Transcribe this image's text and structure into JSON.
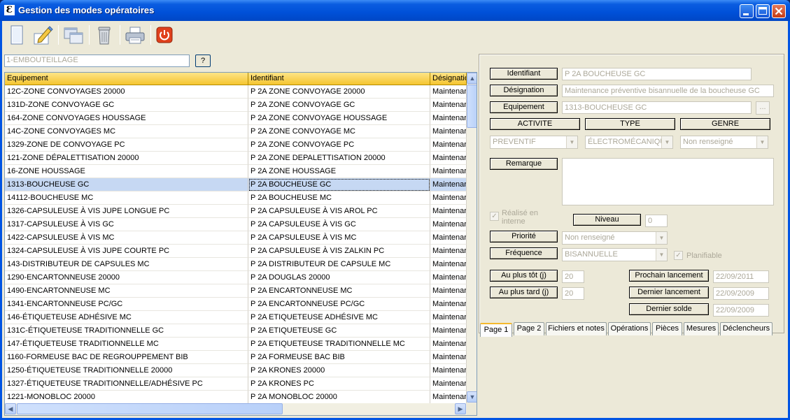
{
  "window": {
    "title": "Gestion des modes opératoires",
    "app_icon": "Ɛ"
  },
  "toolbar": {
    "tools": [
      {
        "name": "new-document-icon"
      },
      {
        "name": "edit-pencil-icon"
      },
      {
        "name": "duplicate-windows-icon"
      },
      {
        "name": "trash-icon"
      },
      {
        "name": "printer-icon"
      },
      {
        "name": "power-quit-icon"
      }
    ]
  },
  "filter": {
    "value": "1-EMBOUTEILLAGE",
    "button_label": "?"
  },
  "grid": {
    "columns": [
      "Equipement",
      "Identifiant",
      "Désignation"
    ],
    "rows": [
      [
        "12C-ZONE CONVOYAGES 20000",
        "P 2A  ZONE CONVOYAGE 20000",
        "Maintenar"
      ],
      [
        "131D-ZONE CONVOYAGE GC",
        "P 2A  ZONE CONVOYAGE GC",
        "Maintenar"
      ],
      [
        "164-ZONE CONVOYAGES HOUSSAGE",
        "P 2A  ZONE CONVOYAGE HOUSSAGE",
        "Maintenar"
      ],
      [
        "14C-ZONE CONVOYAGES MC",
        "P 2A  ZONE CONVOYAGE MC",
        "Maintenar"
      ],
      [
        "1329-ZONE DE CONVOYAGE PC",
        "P 2A  ZONE CONVOYAGE PC",
        "Maintenar"
      ],
      [
        "121-ZONE DÉPALETTISATION 20000",
        "P 2A  ZONE DEPALETTISATION 20000",
        "Maintenar"
      ],
      [
        "16-ZONE HOUSSAGE",
        "P 2A  ZONE HOUSSAGE",
        "Maintenar"
      ],
      [
        "1313-BOUCHEUSE GC",
        "P 2A BOUCHEUSE GC",
        "Maintenar"
      ],
      [
        "14112-BOUCHEUSE MC",
        "P 2A BOUCHEUSE MC",
        "Maintenar"
      ],
      [
        "1326-CAPSULEUSE À VIS JUPE LONGUE PC",
        "P 2A CAPSULEUSE À VIS AROL PC",
        "Maintenar"
      ],
      [
        "1317-CAPSULEUSE À VIS GC",
        "P 2A CAPSULEUSE À VIS GC",
        "Maintenar"
      ],
      [
        "1422-CAPSULEUSE À VIS MC",
        "P 2A CAPSULEUSE À VIS MC",
        "Maintenar"
      ],
      [
        "1324-CAPSULEUSE À VIS JUPE COURTE PC",
        "P 2A CAPSULEUSE À VIS ZALKIN PC",
        "Maintenar"
      ],
      [
        "143-DISTRIBUTEUR DE CAPSULES MC",
        "P 2A DISTRIBUTEUR DE CAPSULE MC",
        "Maintenar"
      ],
      [
        "1290-ENCARTONNEUSE 20000",
        "P 2A DOUGLAS 20000",
        "Maintenar"
      ],
      [
        "1490-ENCARTONNEUSE MC",
        "P 2A ENCARTONNEUSE MC",
        "Maintenar"
      ],
      [
        "1341-ENCARTONNEUSE PC/GC",
        "P 2A ENCARTONNEUSE PC/GC",
        "Maintenar"
      ],
      [
        "146-ÉTIQUETEUSE ADHÉSIVE MC",
        "P 2A ETIQUETEUSE  ADHÉSIVE MC",
        "Maintenar"
      ],
      [
        "131C-ÉTIQUETEUSE TRADITIONNELLE GC",
        "P 2A ETIQUETEUSE GC",
        "Maintenar"
      ],
      [
        "147-ÉTIQUETEUSE TRADITIONNELLE MC",
        "P 2A ETIQUETEUSE TRADITIONNELLE MC",
        "Maintenar"
      ],
      [
        "1160-FORMEUSE BAC DE REGROUPPEMENT BIB",
        "P 2A FORMEUSE BAC BIB",
        "Maintenar"
      ],
      [
        "1250-ÉTIQUETEUSE TRADITIONNELLE 20000",
        "P 2A KRONES 20000",
        "Maintenar"
      ],
      [
        "1327-ÉTIQUETEUSE TRADITIONNELLE/ADHÉSIVE PC",
        "P 2A KRONES PC",
        "Maintenar"
      ],
      [
        "1221-MONOBLOC 20000",
        "P 2A MONOBLOC 20000",
        "Maintenar"
      ]
    ],
    "selected_row": 7
  },
  "detail": {
    "identifiant": {
      "label": "Identifiant",
      "value": "P 2A BOUCHEUSE GC"
    },
    "designation": {
      "label": "Désignation",
      "value": "Maintenance préventive bisannuelle de la boucheuse GC"
    },
    "equipement": {
      "label": "Equipement",
      "value": "1313-BOUCHEUSE GC",
      "button_label": "..."
    },
    "activite": {
      "label": "ACTIVITE",
      "value": "PREVENTIF"
    },
    "type": {
      "label": "TYPE",
      "value": "ÉLECTROMÉCANIQU"
    },
    "genre": {
      "label": "GENRE",
      "value": "Non renseigné"
    },
    "remarque": {
      "label": "Remarque",
      "value": ""
    },
    "realise_interne": {
      "label": "Réalisé en interne",
      "checked": true
    },
    "niveau": {
      "label": "Niveau",
      "value": "0"
    },
    "priorite": {
      "label": "Priorité",
      "value": "Non renseigné"
    },
    "frequence": {
      "label": "Fréquence",
      "value": "BISANNUELLE"
    },
    "planifiable": {
      "label": "Planifiable",
      "checked": true
    },
    "au_plus_tot": {
      "label": "Au plus tôt (j)",
      "value": "20"
    },
    "au_plus_tard": {
      "label": "Au plus tard (j)",
      "value": "20"
    },
    "prochain_lancement": {
      "label": "Prochain lancement",
      "value": "22/09/2011"
    },
    "dernier_lancement": {
      "label": "Dernier lancement",
      "value": "22/09/2009"
    },
    "dernier_solde": {
      "label": "Dernier solde",
      "value": "22/09/2009"
    }
  },
  "tabs": [
    "Page 1",
    "Page 2",
    "Fichiers et notes",
    "Opérations",
    "Pièces",
    "Mesures",
    "Déclencheurs"
  ],
  "active_tab": 0,
  "colors": {
    "title_bar": "#0054e3",
    "grid_header": "#f5c530",
    "selected_row": "#c6d8f3",
    "active_tab_accent": "#f4b92d"
  }
}
